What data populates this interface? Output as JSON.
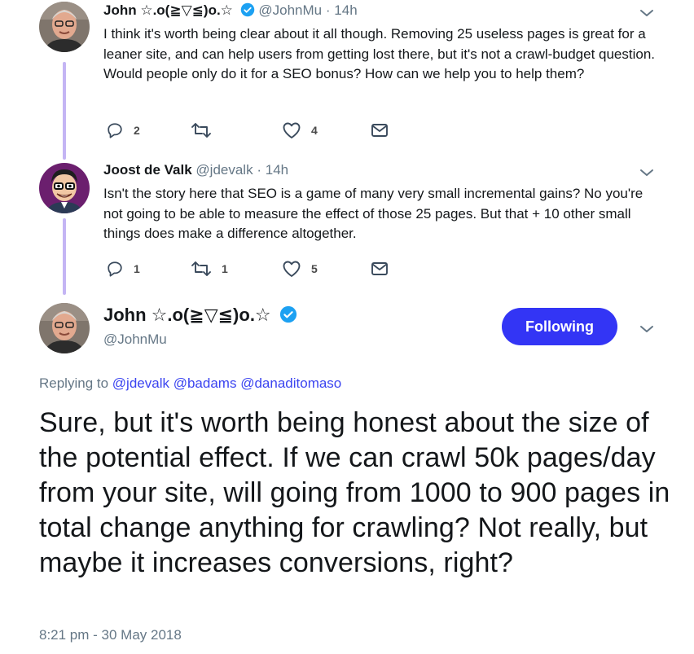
{
  "tweets": [
    {
      "name": "John ☆.o(≧▽≦)o.☆",
      "handle": "@JohnMu",
      "time": "14h",
      "separator": "·",
      "text": "I think it's worth being clear about it all though. Removing 25 useless pages is great for a leaner site, and can help users from getting lost there, but it's not a crawl-budget question. Would people only do it for a SEO bonus? How can we help you to help them?",
      "replies": "2",
      "retweets": "",
      "likes": "4"
    },
    {
      "name": "Joost de Valk",
      "handle": "@jdevalk",
      "time": "14h",
      "separator": "·",
      "text": "Isn't the story here that SEO is a game of many very small incremental gains? No you're not going to be able to measure the effect of those 25 pages. But that + 10 other small things does make a difference altogether.",
      "replies": "1",
      "retweets": "1",
      "likes": "5"
    }
  ],
  "main": {
    "name": "John ☆.o(≧▽≦)o.☆",
    "handle": "@JohnMu",
    "follow_label": "Following",
    "replying_prefix": "Replying to",
    "mentions": [
      "@jdevalk",
      "@badams",
      "@danaditomaso"
    ],
    "text": "Sure, but it's worth being honest about the size of the potential effect. If we can crawl 50k pages/day from your site, will going from 1000 to 900 pages in total change anything for crawling? Not really, but maybe it increases conversions, right?",
    "timestamp": "8:21 pm - 30 May 2018"
  },
  "colors": {
    "accent": "#3335f5",
    "link": "#3b44f0",
    "muted": "#657786",
    "thread_line": "#c4b5f4",
    "verified": "#1da1f2"
  }
}
